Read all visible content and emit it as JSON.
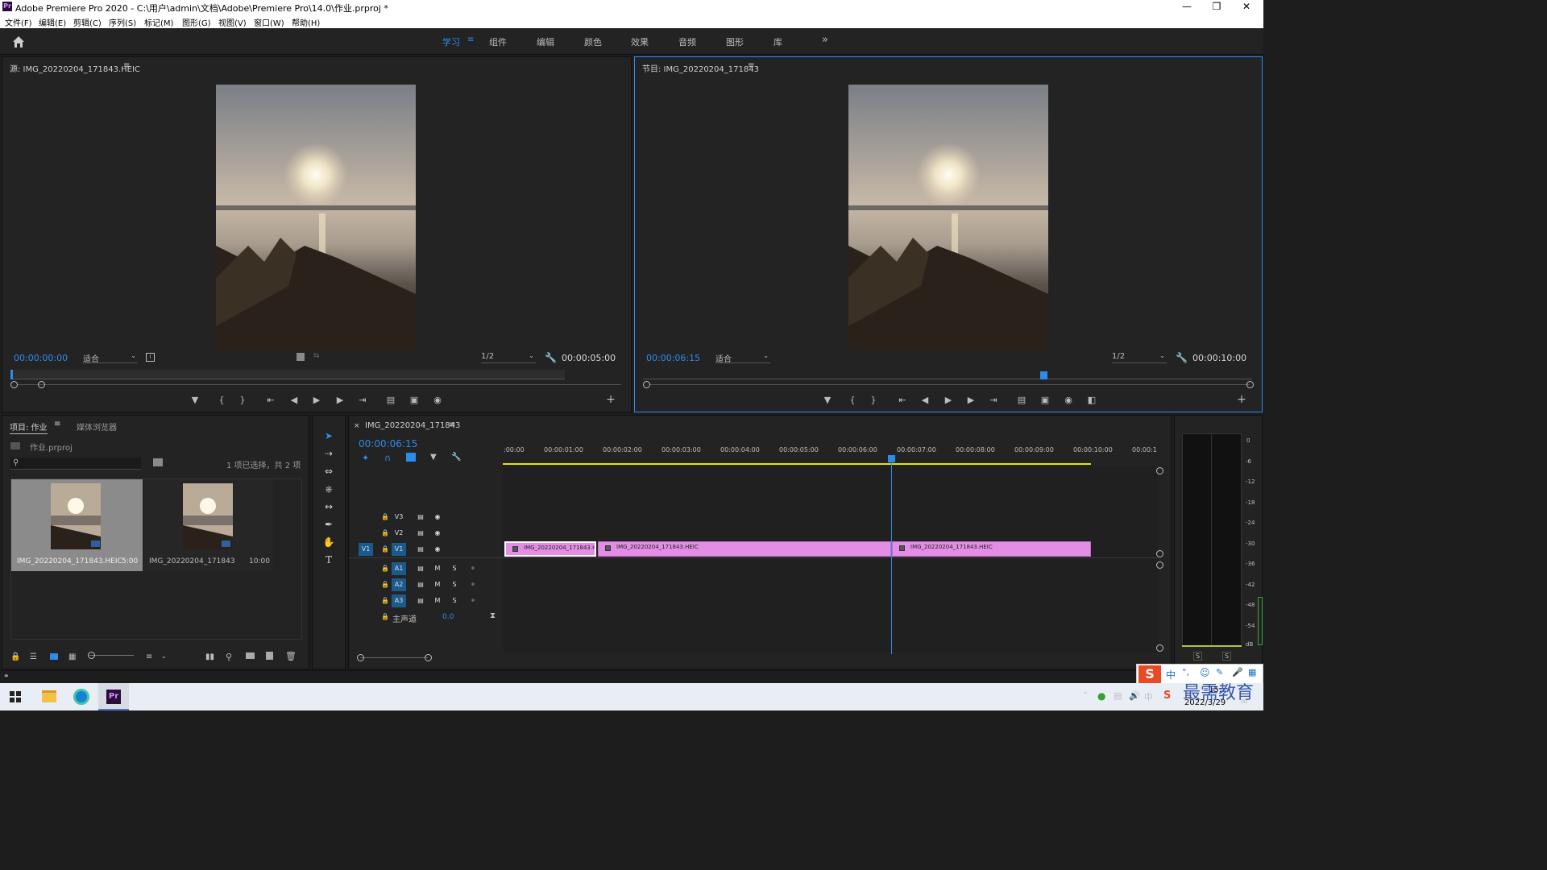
{
  "window": {
    "title": "Adobe Premiere Pro 2020 - C:\\用户\\admin\\文档\\Adobe\\Premiere Pro\\14.0\\作业.prproj *",
    "logo_text": "Pr"
  },
  "menu": [
    "文件(F)",
    "编辑(E)",
    "剪辑(C)",
    "序列(S)",
    "标记(M)",
    "图形(G)",
    "视图(V)",
    "窗口(W)",
    "帮助(H)"
  ],
  "workspaces": [
    "学习",
    "组件",
    "编辑",
    "颜色",
    "效果",
    "音频",
    "图形",
    "库"
  ],
  "active_workspace": "学习",
  "source_monitor": {
    "title": "源: IMG_20220204_171843.HEIC",
    "timecode": "00:00:00:00",
    "fit": "适合",
    "resolution": "1/2",
    "duration": "00:00:05:00"
  },
  "program_monitor": {
    "title": "节目: IMG_20220204_171843",
    "timecode": "00:00:06:15",
    "fit": "适合",
    "resolution": "1/2",
    "duration": "00:00:10:00"
  },
  "project_panel": {
    "tab_project": "项目: 作业",
    "tab_media": "媒体浏览器",
    "file": "作业.prproj",
    "selection_info": "1 项已选择，共 2 项",
    "items": [
      {
        "name": "IMG_20220204_171843.HEIC",
        "duration": "5:00"
      },
      {
        "name": "IMG_20220204_171843",
        "duration": "10:00"
      }
    ]
  },
  "timeline": {
    "tab": "IMG_20220204_171843",
    "timecode": "00:00:06:15",
    "ruler": [
      ":00:00",
      "00:00:01:00",
      "00:00:02:00",
      "00:00:03:00",
      "00:00:04:00",
      "00:00:05:00",
      "00:00:06:00",
      "00:00:07:00",
      "00:00:08:00",
      "00:00:09:00",
      "00:00:10:00",
      "00:00:1"
    ],
    "video_tracks": [
      "V3",
      "V2",
      "V1"
    ],
    "audio_tracks": [
      "A1",
      "A2",
      "A3"
    ],
    "source_patch_v": "V1",
    "mute_label": "M",
    "solo_label": "S",
    "master_label": "主声道",
    "master_value": "0.0",
    "clips": [
      "IMG_20220204_171843.H",
      "IMG_20220204_171843.HEIC",
      "IMG_20220204_171843.HEIC"
    ]
  },
  "audio_meter": {
    "scale": [
      "0",
      "-6",
      "-12",
      "-18",
      "-24",
      "-30",
      "-36",
      "-42",
      "-48",
      "-54",
      "dB"
    ],
    "solo_buttons": [
      "S",
      "S"
    ]
  },
  "taskbar": {
    "date": "2022/3/29",
    "time": "15:",
    "ime": "中",
    "watermark": "最需教育"
  },
  "colors": {
    "accent": "#2d8ceb",
    "clip": "#e38ee4",
    "panel_bg": "#232323"
  }
}
